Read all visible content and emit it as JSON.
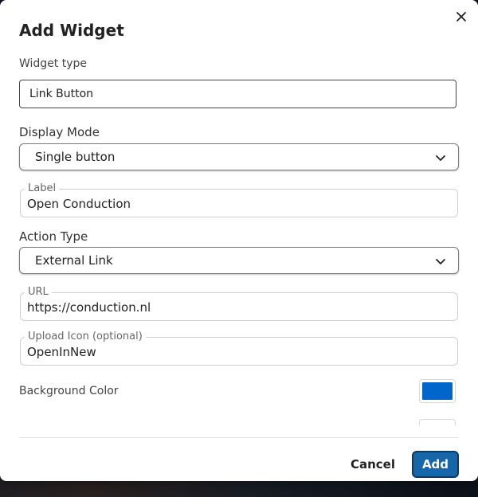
{
  "dialog": {
    "title": "Add Widget",
    "close_icon": "close-icon"
  },
  "widget_type": {
    "label": "Widget type",
    "value": "Link Button"
  },
  "display_mode": {
    "label": "Display Mode",
    "selected": "Single button",
    "icon": "chevron-down-icon"
  },
  "label_field": {
    "legend": "Label",
    "value": "Open Conduction"
  },
  "action_type": {
    "label": "Action Type",
    "selected": "External Link",
    "icon": "chevron-down-icon"
  },
  "url_field": {
    "legend": "URL",
    "value": "https://conduction.nl"
  },
  "icon_field": {
    "legend": "Upload Icon (optional)",
    "value": "OpenInNew"
  },
  "background_color": {
    "label": "Background Color",
    "value": "#0066cc"
  },
  "next_color": {
    "value": "#ffffff"
  },
  "footer": {
    "cancel_label": "Cancel",
    "add_label": "Add",
    "add_color": "#1666a8"
  }
}
